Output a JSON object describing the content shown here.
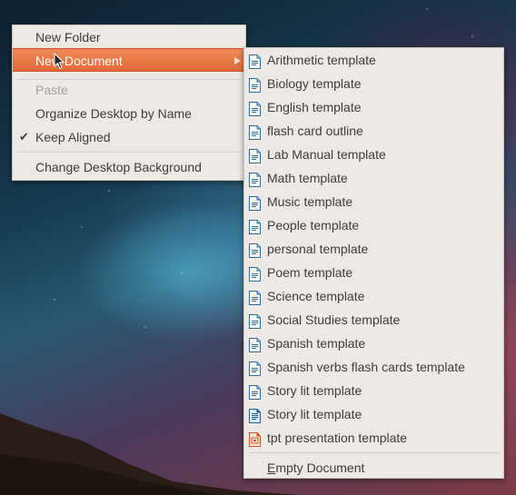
{
  "main_menu": {
    "items": [
      {
        "label": "New Folder",
        "state": "normal"
      },
      {
        "label": "New Document",
        "state": "highlighted",
        "has_submenu": true
      },
      {
        "label": "Paste",
        "state": "disabled"
      },
      {
        "label": "Organize Desktop by Name",
        "state": "normal"
      },
      {
        "label": "Keep Aligned",
        "state": "checked",
        "check_glyph": "✔"
      },
      {
        "label": "Change Desktop Background",
        "state": "normal"
      }
    ]
  },
  "submenu": {
    "items": [
      {
        "label": "Arithmetic template",
        "icon": "writer-document-icon"
      },
      {
        "label": "Biology template",
        "icon": "writer-document-icon"
      },
      {
        "label": "English template",
        "icon": "writer-document-icon"
      },
      {
        "label": "flash card outline",
        "icon": "writer-document-icon"
      },
      {
        "label": "Lab Manual template",
        "icon": "writer-document-icon"
      },
      {
        "label": "Math template",
        "icon": "writer-document-icon"
      },
      {
        "label": "Music template",
        "icon": "writer-document-icon"
      },
      {
        "label": "People template",
        "icon": "writer-document-icon"
      },
      {
        "label": "personal template",
        "icon": "writer-document-icon"
      },
      {
        "label": "Poem template",
        "icon": "writer-document-icon"
      },
      {
        "label": "Science template",
        "icon": "writer-document-icon"
      },
      {
        "label": "Social Studies template",
        "icon": "writer-document-icon"
      },
      {
        "label": "Spanish template",
        "icon": "writer-document-icon"
      },
      {
        "label": "Spanish verbs flash cards template",
        "icon": "writer-document-icon"
      },
      {
        "label": "Story lit template",
        "icon": "writer-document-icon"
      },
      {
        "label": "Story lit template",
        "icon": "writer-template-icon"
      },
      {
        "label": "tpt presentation template",
        "icon": "impress-presentation-icon"
      }
    ],
    "empty_document": {
      "mnemonic": "E",
      "rest": "mpty Document"
    }
  },
  "colors": {
    "highlight": "#e8743f",
    "menu_bg": "#edeae6",
    "writer_blue": "#2a6ea6",
    "impress_orange": "#d0571c"
  }
}
